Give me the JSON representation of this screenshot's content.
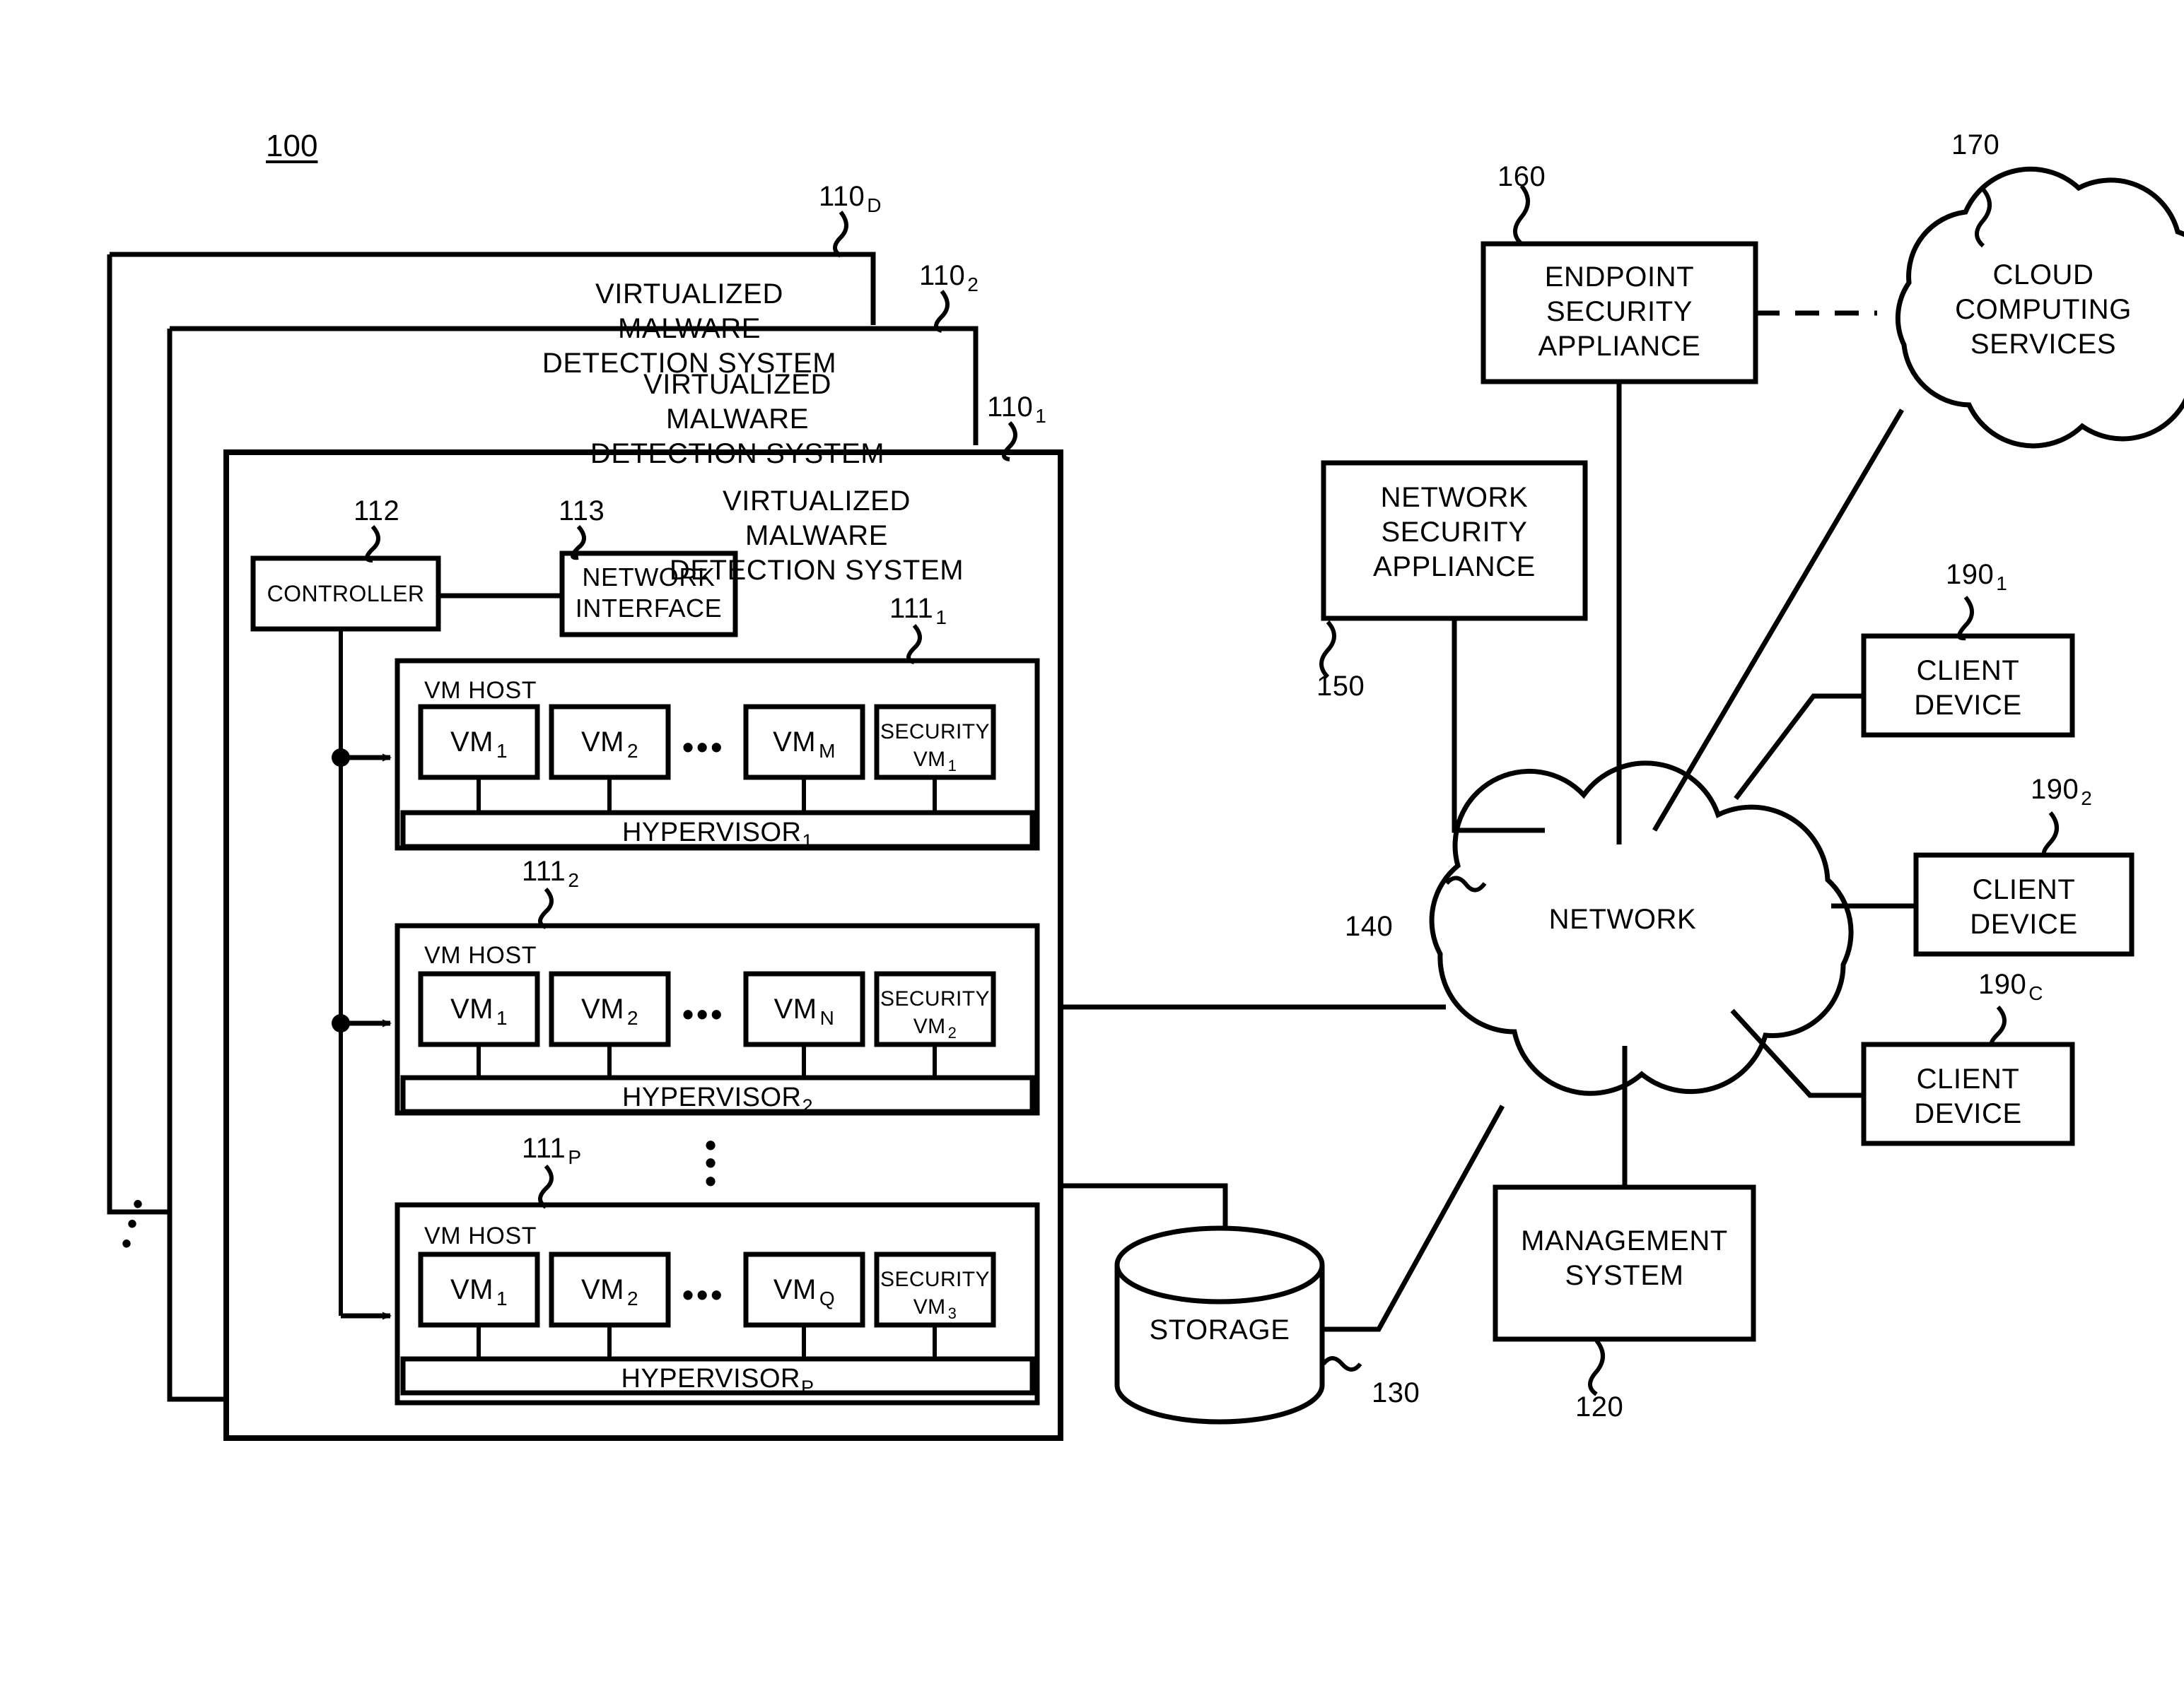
{
  "figure": {
    "figure_number": "100",
    "title_ref": "100"
  },
  "vmds_stack": {
    "back_label": "VIRTUALIZED MALWARE\nDETECTION SYSTEM",
    "back_line1": "VIRTUALIZED MALWARE",
    "back_line2": "DETECTION SYSTEM",
    "ref_back": "110",
    "ref_back_sub": "D",
    "ref_mid": "110",
    "ref_mid_sub": "2",
    "ref_front": "110",
    "ref_front_sub": "1",
    "mid_line1": "VIRTUALIZED MALWARE",
    "mid_line2": "DETECTION SYSTEM",
    "front_line1": "VIRTUALIZED MALWARE",
    "front_line2": "DETECTION SYSTEM"
  },
  "controller": {
    "label": "CONTROLLER",
    "ref": "112"
  },
  "network_interface": {
    "line1": "NETWORK",
    "line2": "INTERFACE",
    "ref": "113"
  },
  "vm_hosts": [
    {
      "host_label": "VM HOST",
      "ref": "111",
      "ref_sub": "1",
      "hypervisor": "HYPERVISOR",
      "hypervisor_sub": "1",
      "vms": [
        {
          "name": "VM",
          "sub": "1"
        },
        {
          "name": "VM",
          "sub": "2"
        },
        {
          "name": "VM",
          "sub": "M"
        }
      ],
      "ellipsis": "•••",
      "security_vm": {
        "line1": "SECURITY",
        "line2": "VM",
        "sub": "1"
      }
    },
    {
      "host_label": "VM HOST",
      "ref": "111",
      "ref_sub": "2",
      "hypervisor": "HYPERVISOR",
      "hypervisor_sub": "2",
      "vms": [
        {
          "name": "VM",
          "sub": "1"
        },
        {
          "name": "VM",
          "sub": "2"
        },
        {
          "name": "VM",
          "sub": "N"
        }
      ],
      "ellipsis": "•••",
      "security_vm": {
        "line1": "SECURITY",
        "line2": "VM",
        "sub": "2"
      }
    },
    {
      "host_label": "VM HOST",
      "ref": "111",
      "ref_sub": "P",
      "hypervisor": "HYPERVISOR",
      "hypervisor_sub": "P",
      "vms": [
        {
          "name": "VM",
          "sub": "1"
        },
        {
          "name": "VM",
          "sub": "2"
        },
        {
          "name": "VM",
          "sub": "Q"
        }
      ],
      "ellipsis": "•••",
      "security_vm": {
        "line1": "SECURITY",
        "line2": "VM",
        "sub": "3"
      }
    }
  ],
  "storage": {
    "label": "STORAGE",
    "ref": "130"
  },
  "network_cloud": {
    "label": "NETWORK",
    "ref": "140"
  },
  "network_security_appliance": {
    "line1": "NETWORK",
    "line2": "SECURITY",
    "line3": "APPLIANCE",
    "ref": "150"
  },
  "endpoint_security_appliance": {
    "line1": "ENDPOINT",
    "line2": "SECURITY",
    "line3": "APPLIANCE",
    "ref": "160"
  },
  "cloud_computing_services": {
    "line1": "CLOUD",
    "line2": "COMPUTING",
    "line3": "SERVICES",
    "ref": "170"
  },
  "management_system": {
    "line1": "MANAGEMENT",
    "line2": "SYSTEM",
    "ref": "120"
  },
  "client_devices": [
    {
      "line1": "CLIENT",
      "line2": "DEVICE",
      "ref": "190",
      "ref_sub": "1"
    },
    {
      "line1": "CLIENT",
      "line2": "DEVICE",
      "ref": "190",
      "ref_sub": "2"
    },
    {
      "line1": "CLIENT",
      "line2": "DEVICE",
      "ref": "190",
      "ref_sub": "C"
    }
  ],
  "ellipses": {
    "vertical_between_hosts": "⋮",
    "diagonal_stack": "⋰"
  },
  "colors": {
    "ink": "#000000",
    "paper": "#ffffff"
  }
}
